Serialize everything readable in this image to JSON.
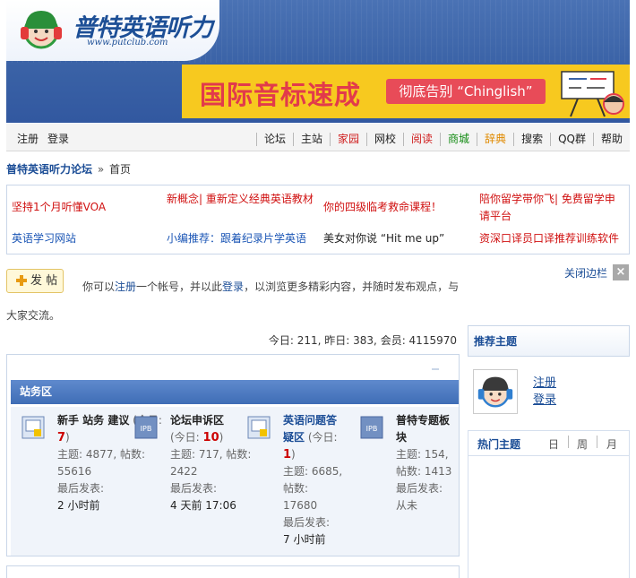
{
  "header": {
    "logo_title": "普特英语听力",
    "logo_url": "www.putclub.com",
    "banner_title": "国际音标速成",
    "banner_pill": "彻底告别 “Chinglish”"
  },
  "nav": {
    "register": "注册",
    "login": "登录",
    "items": [
      {
        "label": "论坛",
        "color": "#222222"
      },
      {
        "label": "主站",
        "color": "#222222"
      },
      {
        "label": "家园",
        "color": "#d02020"
      },
      {
        "label": "网校",
        "color": "#222222"
      },
      {
        "label": "阅读",
        "color": "#d02020"
      },
      {
        "label": "商城",
        "color": "#128a12"
      },
      {
        "label": "辞典",
        "color": "#e08a00"
      },
      {
        "label": "搜索",
        "color": "#222222"
      },
      {
        "label": "QQ群",
        "color": "#222222"
      },
      {
        "label": "帮助",
        "color": "#222222"
      }
    ]
  },
  "breadcrumb": {
    "forum": "普特英语听力论坛",
    "separator": "»",
    "current": "首页"
  },
  "promo": [
    [
      "坚持1个月听懂VOA",
      "新概念| 重新定义经典英语教材",
      "你的四级临考救命课程！",
      "陪你留学带你飞| 免费留学申请平台"
    ],
    [
      "英语学习网站",
      "小编推荐：跟着纪录片学英语",
      "美女对你说 “Hit me up”",
      "资深口译员口译推荐训练软件"
    ]
  ],
  "post": {
    "button_label": "发 帖",
    "intro_prefix": "你可以",
    "intro_register": "注册",
    "intro_middle": "一个帐号，并以此",
    "intro_login": "登录",
    "intro_suffix": "，以浏览更多精彩内容，并随时发布观点，与大家交流。",
    "close_sidebar": "关闭边栏",
    "close_icon": "×"
  },
  "stats": "今日: 211, 昨日: 383, 会员: 4115970",
  "board": {
    "title": "站务区",
    "icon_label": "IPB",
    "forums": [
      {
        "name": "新手 站务 建议",
        "today_prefix": " (今日: ",
        "today": "7",
        "today_suffix": ")",
        "topics_line": "主题: 4877, 帖数: 55616",
        "last_label": "最后发表:",
        "last": "2 小时前"
      },
      {
        "name": "论坛申诉区",
        "today_prefix": " (今日: ",
        "today": "10",
        "today_suffix": ")",
        "topics_line": "主题: 717, 帖数: 2422",
        "last_label": "最后发表:",
        "last": "4 天前 17:06"
      },
      {
        "name": "英语问题答疑区",
        "today_prefix": " (今日: ",
        "today": "1",
        "today_suffix": ")",
        "topics_line": "主题: 6685, 帖数: 17680",
        "last_label": "最后发表:",
        "last": "7 小时前"
      },
      {
        "name": "普特专题板块",
        "today_prefix": "",
        "today": "",
        "today_suffix": "",
        "topics_line": "主题: 154, 帖数: 1413",
        "last_label": "最后发表:",
        "last": "从未"
      }
    ]
  },
  "sidebar": {
    "recommend_title": "推荐主题",
    "register": "注册",
    "login": "登录",
    "hot_title": "热门主题",
    "hot_tabs": [
      "日",
      "周",
      "月"
    ]
  },
  "colors": {
    "brand_blue": "#1b4d96",
    "header_blue": "#3a62a6",
    "promo_red": "#d01010",
    "promo_blue": "#1a55b5",
    "banner_yellow": "#f7c91f"
  }
}
